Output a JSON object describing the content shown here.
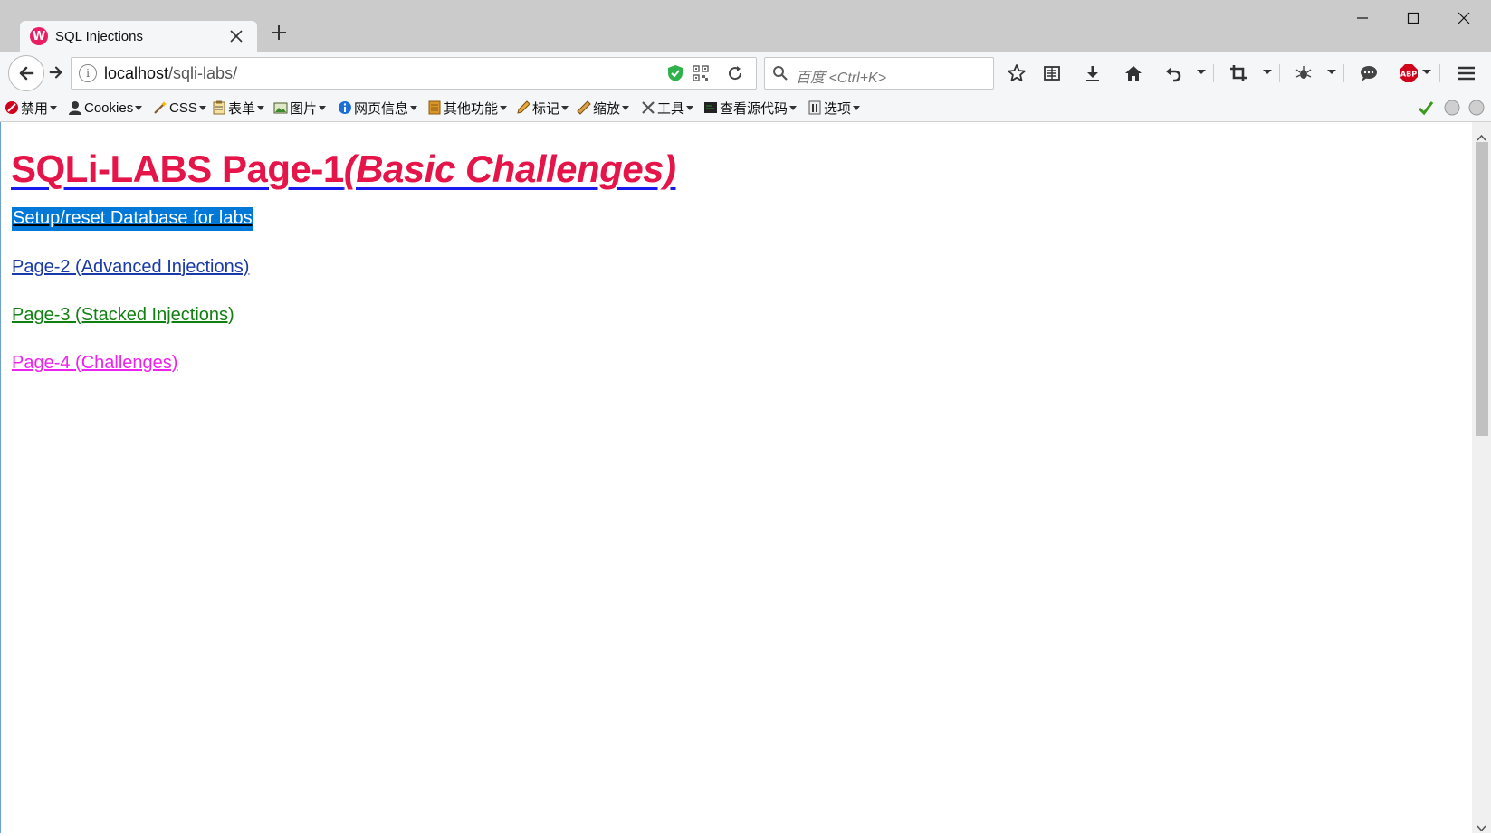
{
  "browser": {
    "tab": {
      "title": "SQL Injections",
      "favicon": "W"
    },
    "url": {
      "host": "localhost",
      "path": "/sqli-labs/"
    },
    "search": {
      "placeholder": "百度 <Ctrl+K>"
    }
  },
  "bookmarks": [
    {
      "label": "禁用",
      "icon": "disable-icon"
    },
    {
      "label": "Cookies",
      "icon": "cookie-icon"
    },
    {
      "label": "CSS",
      "icon": "wand-icon"
    },
    {
      "label": "表单",
      "icon": "form-icon"
    },
    {
      "label": "图片",
      "icon": "image-icon"
    },
    {
      "label": "网页信息",
      "icon": "info-icon"
    },
    {
      "label": "其他功能",
      "icon": "misc-icon"
    },
    {
      "label": "标记",
      "icon": "pencil-icon"
    },
    {
      "label": "缩放",
      "icon": "ruler-icon"
    },
    {
      "label": "工具",
      "icon": "tools-icon"
    },
    {
      "label": "查看源代码",
      "icon": "source-icon"
    },
    {
      "label": "选项",
      "icon": "options-icon"
    }
  ],
  "page": {
    "title_main": "SQLi-LABS Page-1",
    "title_sub": "(Basic Challenges)",
    "links": [
      {
        "text": "Setup/reset Database for labs",
        "color": "#ffffff",
        "selected": true
      },
      {
        "text": "Page-2 (Advanced Injections)",
        "color": "#1a3aa8"
      },
      {
        "text": "Page-3 (Stacked Injections)",
        "color": "#108010"
      },
      {
        "text": "Page-4 (Challenges)",
        "color": "#ee22ee"
      }
    ]
  },
  "colors": {
    "title": "#e5154a",
    "title_underline": "#1a1aee",
    "selection": "#0078d7"
  }
}
